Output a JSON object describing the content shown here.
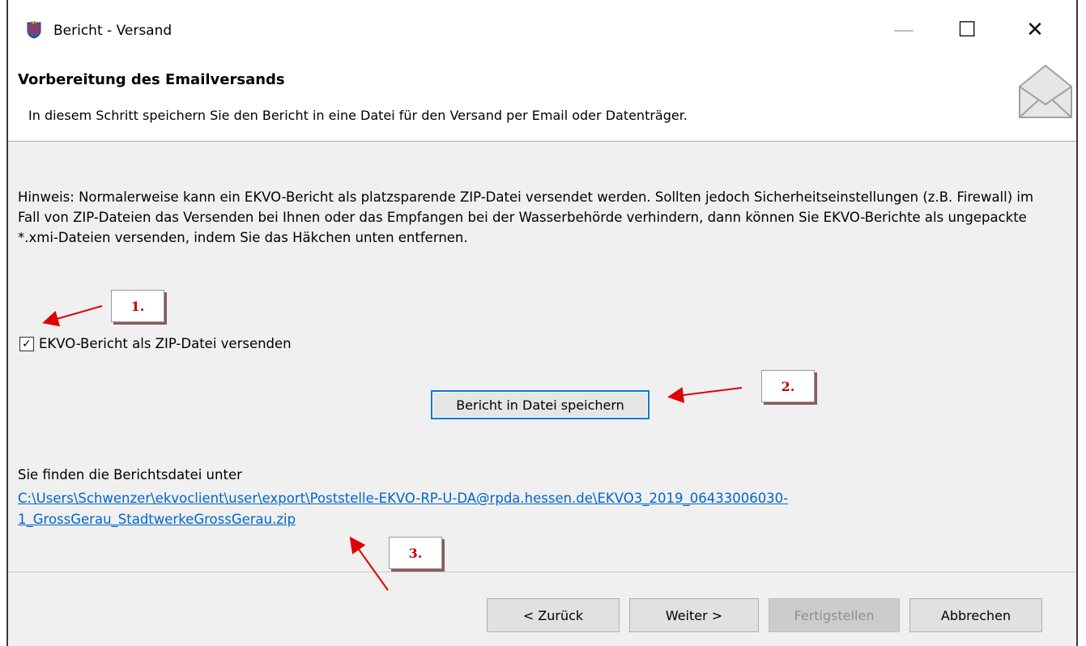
{
  "window": {
    "title": "Bericht - Versand",
    "minimize_glyph": "—",
    "maximize_glyph": "☐",
    "close_glyph": "✕"
  },
  "header": {
    "title": "Vorbereitung des Emailversands",
    "description": "In diesem Schritt speichern Sie den Bericht in eine Datei für den Versand per Email oder Datenträger.",
    "icon": "envelope-icon"
  },
  "content": {
    "hint": "Hinweis: Normalerweise kann ein EKVO-Bericht als platzsparende ZIP-Datei versendet werden. Sollten jedoch Sicherheitseinstellungen (z.B. Firewall) im Fall von ZIP-Dateien das Versenden bei Ihnen oder das Empfangen bei der Wasserbehörde verhindern, dann können Sie EKVO-Berichte als ungepackte *.xmi-Dateien versenden, indem Sie das Häkchen unten entfernen.",
    "checkbox_label": "EKVO-Bericht als ZIP-Datei versenden",
    "checkbox_checked": true,
    "save_button": "Bericht in Datei speichern",
    "path_label": "Sie finden die Berichtsdatei unter",
    "path_link": "C:\\Users\\Schwenzer\\ekvoclient\\user\\export\\Poststelle-EKVO-RP-U-DA@rpda.hessen.de\\EKVO3_2019_06433006030-1_GrossGerau_StadtwerkeGrossGerau.zip"
  },
  "callouts": [
    "1.",
    "2.",
    "3."
  ],
  "footer": {
    "back": "< Zurück",
    "next": "Weiter >",
    "finish": "Fertigstellen",
    "cancel": "Abbrechen"
  },
  "colors": {
    "accent": "#0078d7",
    "link": "#0066cc",
    "callout_text": "#c00000",
    "arrow": "#e00000"
  }
}
